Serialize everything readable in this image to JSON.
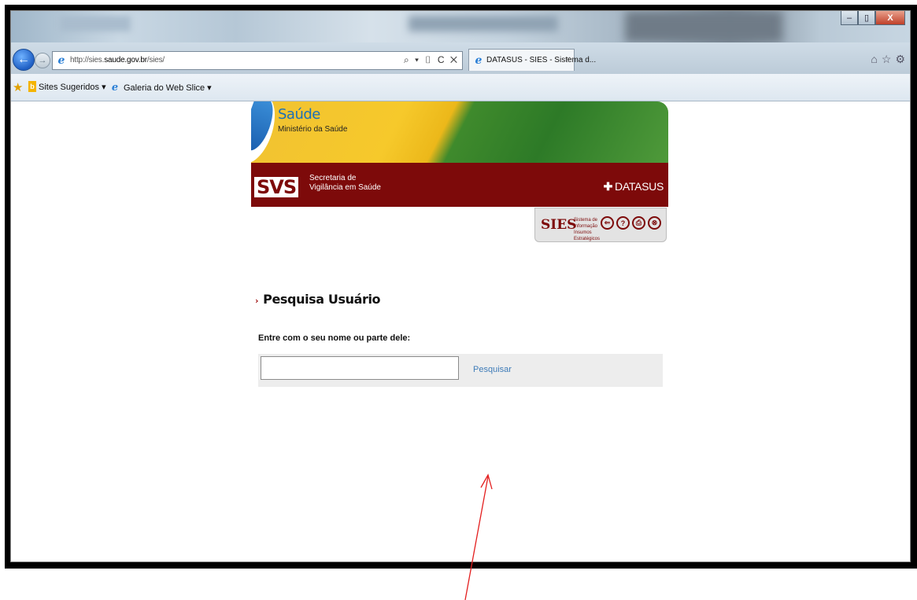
{
  "browser": {
    "url_prefix": "http://sies.",
    "url_domain": "saude.gov.br",
    "url_path": "/sies/",
    "address_tools": "⌕ ▾ ▯ C ✕",
    "tab_title": "DATASUS - SIES - Sistema d...",
    "tab_close": "×",
    "window_controls": {
      "minimize": "–",
      "maximize": "▯",
      "close": "X"
    },
    "right_icons": [
      "⌂",
      "☆",
      "⚙"
    ]
  },
  "favorites": {
    "items": [
      {
        "label": "Sites Sugeridos ▾"
      },
      {
        "label": "Galeria do Web Slice ▾"
      }
    ]
  },
  "banner": {
    "saude_title": "Saúde",
    "saude_subtitle": "Ministério da Saúde",
    "svs_logo": "SVS",
    "svs_line1": "Secretaria de",
    "svs_line2": "Vigilância em Saúde",
    "datasus_cross": "✚",
    "datasus": "DATASUS",
    "sies_logo": "SIES",
    "sies_desc": "Sistema de Informação Insumos Estratégicos",
    "sies_icons": [
      "⇐",
      "?",
      "⎙",
      "⊗"
    ]
  },
  "form": {
    "section_arrow": "›",
    "title": "Pesquisa Usuário",
    "label": "Entre com o seu nome ou parte dele:",
    "input_value": "",
    "search_link": "Pesquisar"
  },
  "colors": {
    "banner_red": "#7d0a0a",
    "link_blue": "#3f7cb8",
    "annotation_red": "#e31e1e"
  }
}
